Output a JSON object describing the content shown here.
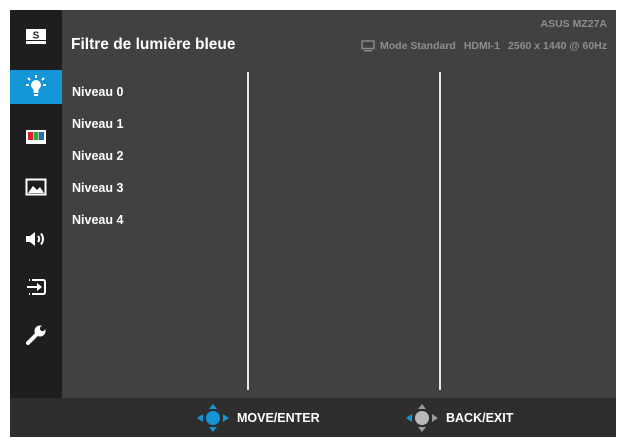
{
  "header": {
    "title": "Filtre de lumière bleue",
    "model": "ASUS MZ27A",
    "mode": "Mode Standard",
    "input": "HDMI-1",
    "resolution": "2560 x 1440 @ 60Hz"
  },
  "sidebar": {
    "items": [
      {
        "name": "splendid",
        "icon": "splendid-s-icon",
        "active": false
      },
      {
        "name": "blue-light-filter",
        "icon": "light-bulb-icon",
        "active": true
      },
      {
        "name": "color",
        "icon": "color-bars-icon",
        "active": false
      },
      {
        "name": "image",
        "icon": "landscape-image-icon",
        "active": false
      },
      {
        "name": "sound",
        "icon": "speaker-icon",
        "active": false
      },
      {
        "name": "input-select",
        "icon": "input-arrow-icon",
        "active": false
      },
      {
        "name": "system-setup",
        "icon": "wrench-icon",
        "active": false
      }
    ],
    "splendid_letter": "S"
  },
  "options": [
    "Niveau 0",
    "Niveau 1",
    "Niveau 2",
    "Niveau 3",
    "Niveau 4"
  ],
  "footer": {
    "move_label": "MOVE/ENTER",
    "back_label": "BACK/EXIT",
    "move_icon": "joystick-blue-icon",
    "back_icon": "joystick-gray-icon"
  },
  "colors": {
    "accent": "#1495d6",
    "background": "#414141",
    "sidebar": "#1e1e1e",
    "footer": "#2e2e2e",
    "status_text": "#8e8e8e"
  }
}
